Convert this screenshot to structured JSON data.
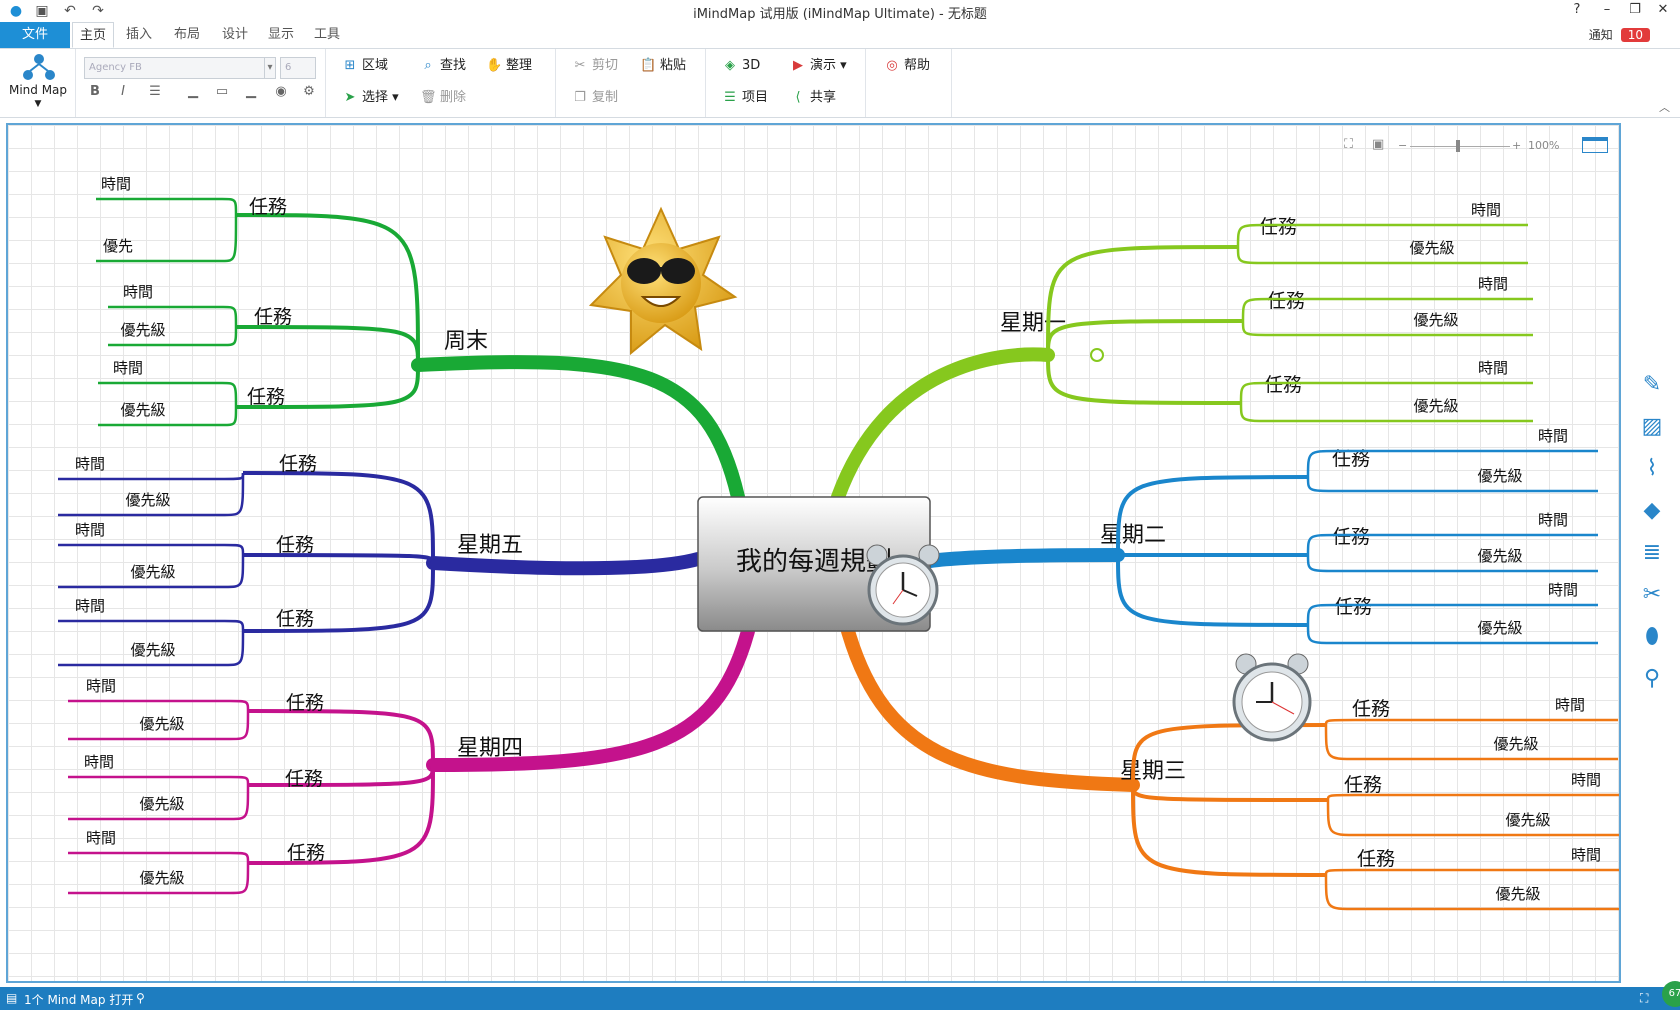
{
  "window": {
    "title": "iMindMap 试用版 (iMindMap Ultimate) - 无标题"
  },
  "tabs": [
    {
      "label": "文件"
    },
    {
      "label": "主页"
    },
    {
      "label": "插入"
    },
    {
      "label": "布局"
    },
    {
      "label": "设计"
    },
    {
      "label": "显示"
    },
    {
      "label": "工具"
    }
  ],
  "notify": {
    "label": "通知",
    "count": "10"
  },
  "ribbon": {
    "mindmap_label": "Mind Map",
    "font_name": "Agency FB",
    "font_size": "6",
    "area": "区域",
    "find": "查找",
    "tidy": "整理",
    "select": "选择",
    "delete": "删除",
    "cut": "剪切",
    "paste": "粘贴",
    "copy": "复制",
    "view3d": "3D",
    "present": "演示",
    "help": "帮助",
    "items": "项目",
    "share": "共享"
  },
  "zoom": {
    "value": "100%"
  },
  "map": {
    "central": "我的每週規劃",
    "branches": [
      {
        "key": "weekend",
        "label": "周末",
        "color": "#19a935",
        "tasks": [
          {
            "label": "任務",
            "leaves": [
              "時間",
              "優先"
            ]
          },
          {
            "label": "任務",
            "leaves": [
              "時間",
              "優先級"
            ]
          },
          {
            "label": "任務",
            "leaves": [
              "時間",
              "優先級"
            ]
          }
        ]
      },
      {
        "key": "fri",
        "label": "星期五",
        "color": "#2a2aa0",
        "tasks": [
          {
            "label": "任務",
            "leaves": [
              "時間",
              "優先級"
            ]
          },
          {
            "label": "任務",
            "leaves": [
              "時間",
              "優先級"
            ]
          },
          {
            "label": "任務",
            "leaves": [
              "時間",
              "優先級"
            ]
          }
        ]
      },
      {
        "key": "thu",
        "label": "星期四",
        "color": "#c4128c",
        "tasks": [
          {
            "label": "任務",
            "leaves": [
              "時間",
              "優先級"
            ]
          },
          {
            "label": "任務",
            "leaves": [
              "時間",
              "優先級"
            ]
          },
          {
            "label": "任務",
            "leaves": [
              "時間",
              "優先級"
            ]
          }
        ]
      },
      {
        "key": "mon",
        "label": "星期一",
        "color": "#86c81e",
        "tasks": [
          {
            "label": "任務",
            "leaves": [
              "時間",
              "優先級"
            ]
          },
          {
            "label": "任務",
            "leaves": [
              "時間",
              "優先級"
            ]
          },
          {
            "label": "任務",
            "leaves": [
              "時間",
              "優先級"
            ]
          }
        ]
      },
      {
        "key": "tue",
        "label": "星期二",
        "color": "#1a86cc",
        "tasks": [
          {
            "label": "任務",
            "leaves": [
              "時間",
              "優先級"
            ]
          },
          {
            "label": "任務",
            "leaves": [
              "時間",
              "優先級"
            ]
          },
          {
            "label": "任務",
            "leaves": [
              "時間",
              "優先級"
            ]
          }
        ]
      },
      {
        "key": "wed",
        "label": "星期三",
        "color": "#f07814",
        "tasks": [
          {
            "label": "任務",
            "leaves": [
              "時間",
              "優先級"
            ]
          },
          {
            "label": "任務",
            "leaves": [
              "時間",
              "優先級"
            ]
          },
          {
            "label": "任務",
            "leaves": [
              "時間",
              "優先級"
            ]
          }
        ]
      }
    ]
  },
  "status": {
    "text": "1个 Mind Map 打开",
    "badge": "67"
  }
}
